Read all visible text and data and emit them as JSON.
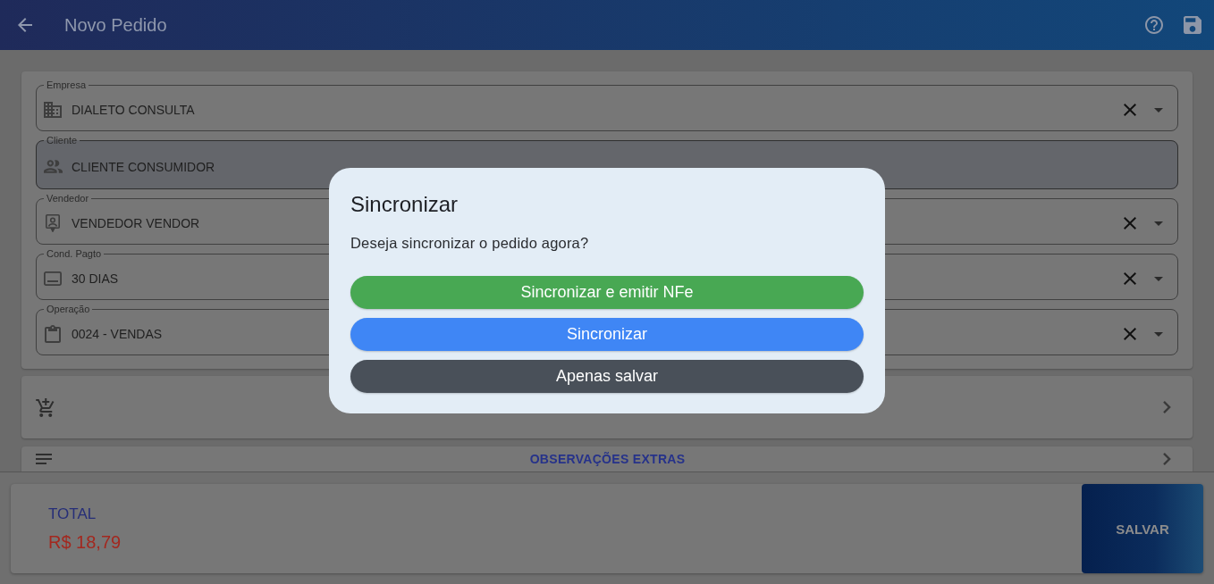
{
  "app_bar": {
    "title": "Novo Pedido"
  },
  "fields": [
    {
      "label": "Empresa",
      "value": "DIALETO CONSULTA",
      "readonly": false
    },
    {
      "label": "Cliente",
      "value": "CLIENTE CONSUMIDOR",
      "readonly": true
    },
    {
      "label": "Vendedor",
      "value": "VENDEDOR VENDOR",
      "readonly": false
    },
    {
      "label": "Cond. Pagto",
      "value": "30 DIAS",
      "readonly": false
    },
    {
      "label": "Operação",
      "value": "0024 - VENDAS",
      "readonly": false
    }
  ],
  "sections": [
    {
      "kind": "icon_only"
    },
    {
      "kind": "titled",
      "title": "OBSERVAÇÕES EXTRAS"
    }
  ],
  "footer": {
    "total_label": "TOTAL",
    "total_value": "R$ 18,79",
    "save_button": "SALVAR"
  },
  "dialog": {
    "title": "Sincronizar",
    "message": "Deseja sincronizar o pedido agora?",
    "buttons": [
      {
        "label": "Sincronizar e emitir NFe",
        "color": "#48a853"
      },
      {
        "label": "Sincronizar",
        "color": "#3f86f5"
      },
      {
        "label": "Apenas salvar",
        "color": "#495059"
      }
    ]
  }
}
